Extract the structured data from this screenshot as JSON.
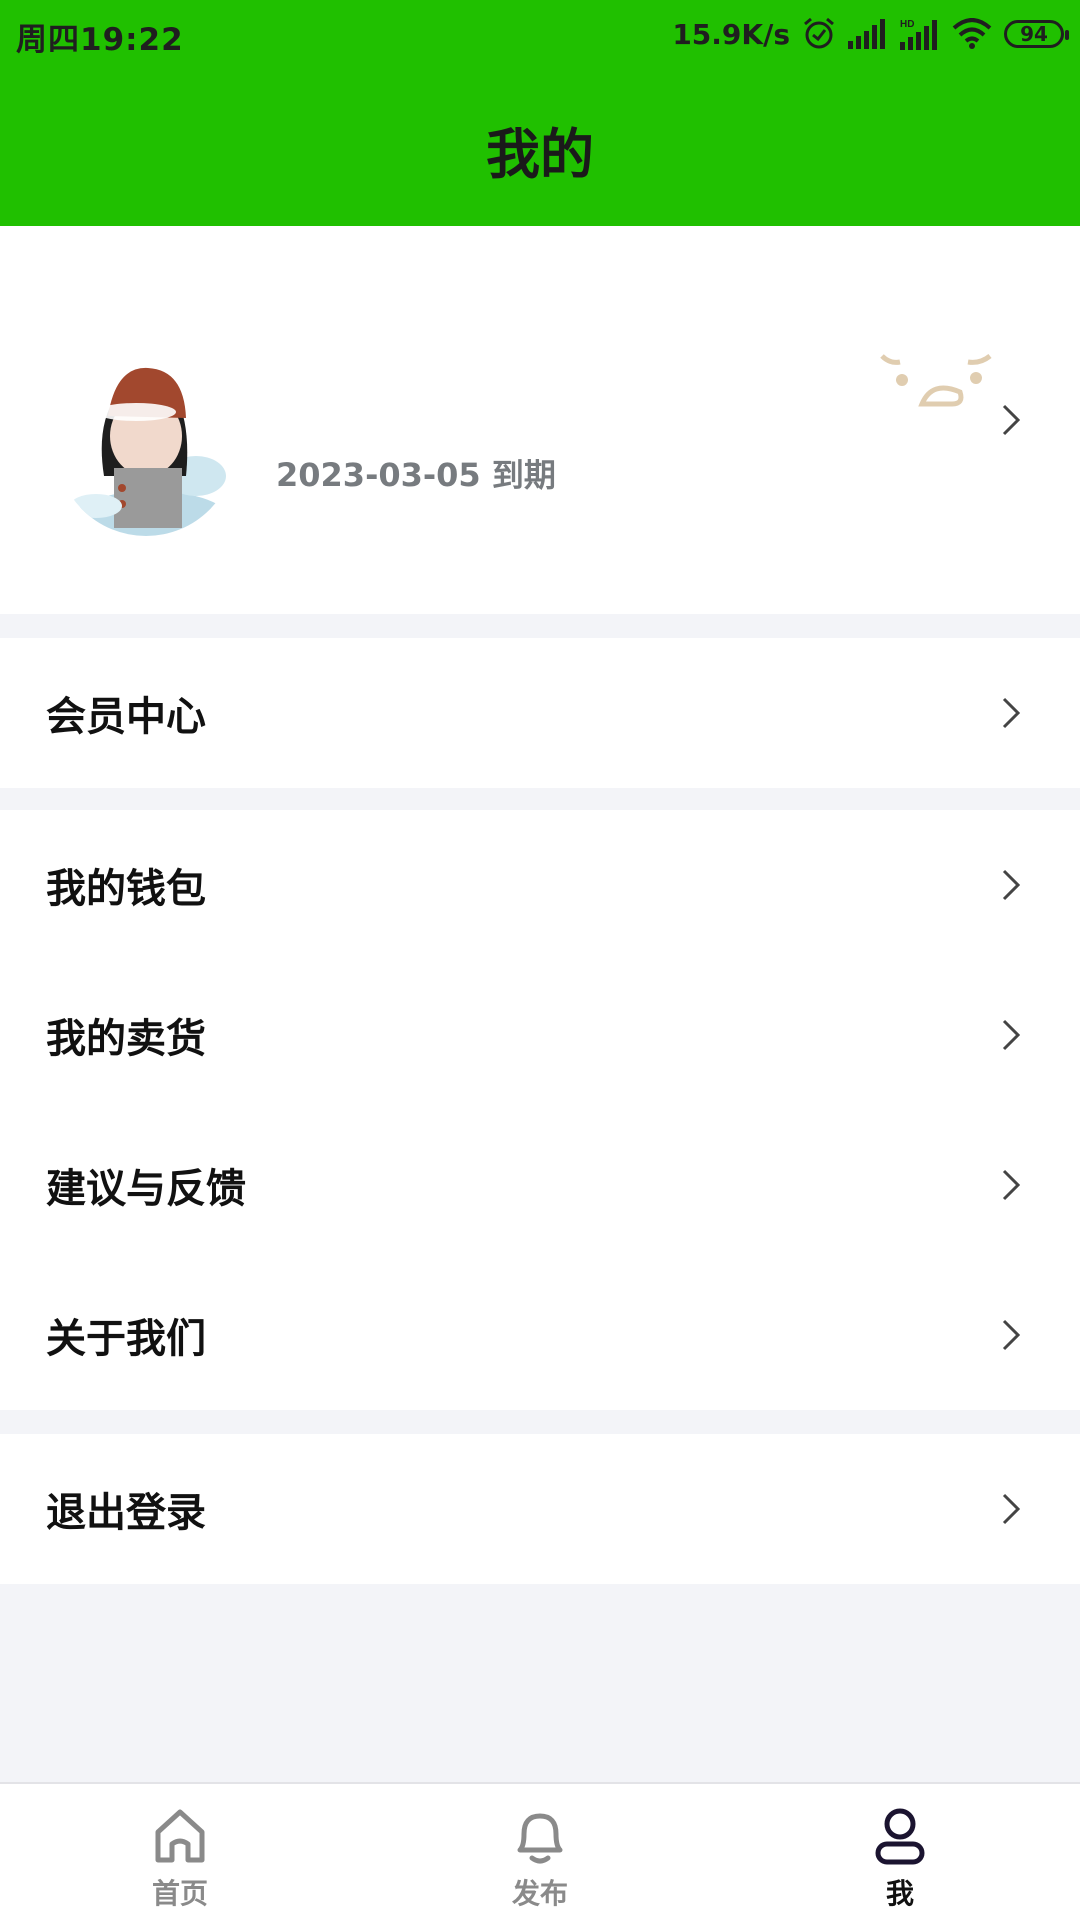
{
  "status_bar": {
    "time": "周四19:22",
    "net_speed": "15.9K/s",
    "battery": "94",
    "icons": [
      "alarm-icon",
      "signal-icon",
      "hd-signal-icon",
      "wifi-icon",
      "battery-icon"
    ]
  },
  "header": {
    "title": "我的",
    "background": "#20c000"
  },
  "profile": {
    "expiry": "2023-03-05 到期",
    "avatar_icon": "avatar-illustration"
  },
  "sections": [
    {
      "items": [
        {
          "label": "会员中心"
        }
      ]
    },
    {
      "items": [
        {
          "label": "我的钱包"
        },
        {
          "label": "我的卖货"
        },
        {
          "label": "建议与反馈"
        },
        {
          "label": "关于我们"
        }
      ]
    },
    {
      "items": [
        {
          "label": "退出登录"
        }
      ]
    }
  ],
  "bottom_nav": {
    "items": [
      {
        "label": "首页",
        "icon": "home-icon",
        "active": false
      },
      {
        "label": "发布",
        "icon": "bell-icon",
        "active": false
      },
      {
        "label": "我",
        "icon": "user-icon",
        "active": true
      }
    ]
  }
}
